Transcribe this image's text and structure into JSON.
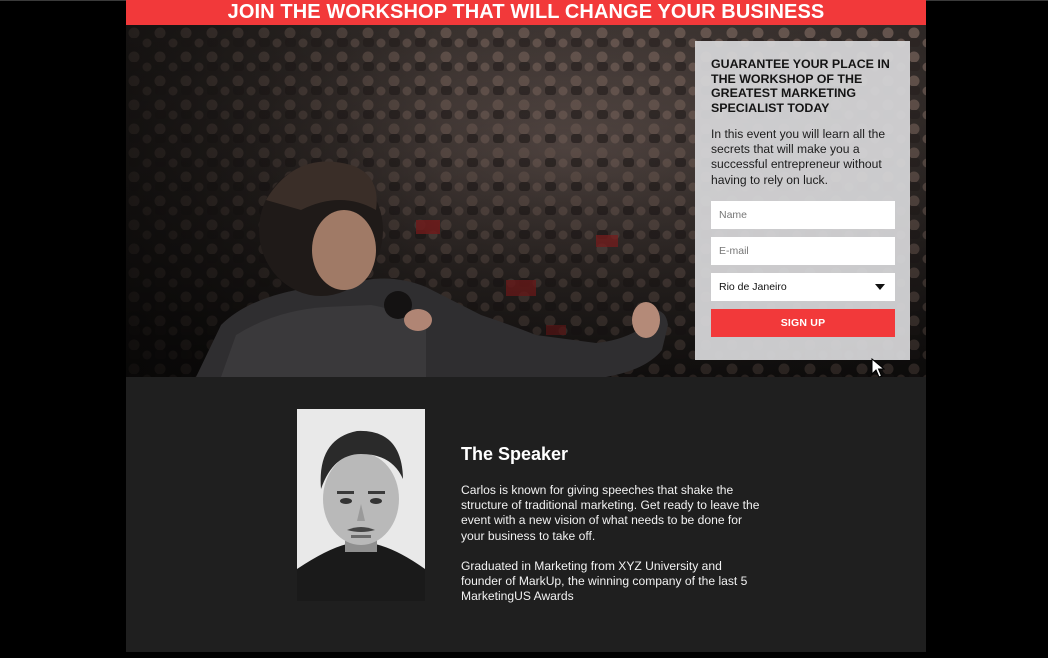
{
  "banner": {
    "title": "JOIN THE WORKSHOP THAT WILL CHANGE YOUR BUSINESS"
  },
  "hero": {
    "image": "speaker-on-stage-audience-photo"
  },
  "signup": {
    "heading": "GUARANTEE YOUR PLACE IN THE WORKSHOP OF THE GREATEST MARKETING SPECIALIST TODAY",
    "description": "In this event you will learn all the secrets that will make you a successful entrepreneur without having to rely on luck.",
    "name_placeholder": "Name",
    "email_placeholder": "E-mail",
    "city_value": "Rio de Janeiro",
    "button_label": "SIGN UP"
  },
  "speaker": {
    "title": "The Speaker",
    "photo": "speaker-portrait-bw",
    "bio_1": "Carlos is known for giving speeches that shake the structure of traditional marketing. Get ready to leave the event with a new vision of what needs to be done for your business to take off.",
    "bio_2": "Graduated in Marketing from XYZ University and founder of MarkUp, the winning company of the last 5 MarketingUS Awards"
  },
  "colors": {
    "accent": "#f2393a",
    "dark_section": "#1f1f1f",
    "card": "#d6d6d8"
  }
}
